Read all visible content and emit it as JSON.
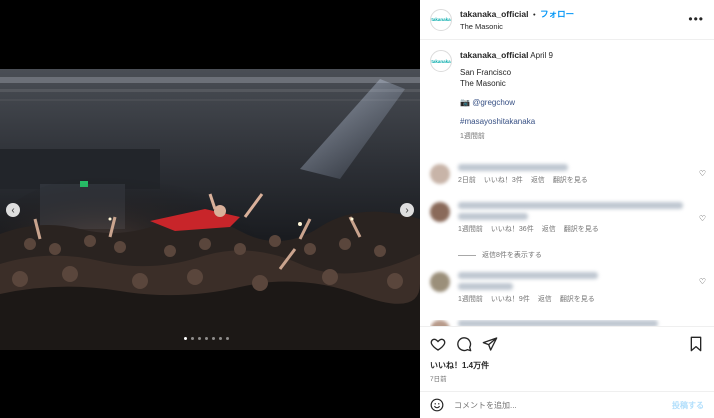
{
  "header": {
    "username": "takanaka_official",
    "separator": "•",
    "follow_label": "フォロー",
    "location": "The Masonic",
    "more_icon": "more-horizontal-icon",
    "avatar_text": "takanaka"
  },
  "caption": {
    "username": "takanaka_official",
    "date": "April 9",
    "line1": "San Francisco",
    "line2": "The Masonic",
    "camera_emoji": "📷",
    "credit": "@gregchow",
    "hashtag": "#masayoshitakanaka",
    "age": "1週間前"
  },
  "comments": [
    {
      "age": "2日前",
      "likes": "いいね！3件",
      "reply": "返信",
      "translate": "翻訳を見る"
    },
    {
      "age": "1週間前",
      "likes": "いいね！36件",
      "reply": "返信",
      "translate": "翻訳を見る",
      "view_replies": "返信8件を表示する"
    },
    {
      "age": "1週間前",
      "likes": "いいね！9件",
      "reply": "返信",
      "translate": "翻訳を見る"
    }
  ],
  "actions": {
    "icons": [
      "heart-icon",
      "comment-icon",
      "share-icon",
      "bookmark-icon"
    ]
  },
  "stats": {
    "likes": "いいね！1.4万件",
    "age": "7日前"
  },
  "comment_box": {
    "placeholder": "コメントを追加...",
    "post_label": "投稿する",
    "emoji_icon": "smiley-icon"
  },
  "carousel": {
    "slide_count": 7,
    "active_index": 0
  },
  "colors": {
    "follow": "#0095f6",
    "link": "#385185",
    "post_disabled": "#b2dffc"
  }
}
